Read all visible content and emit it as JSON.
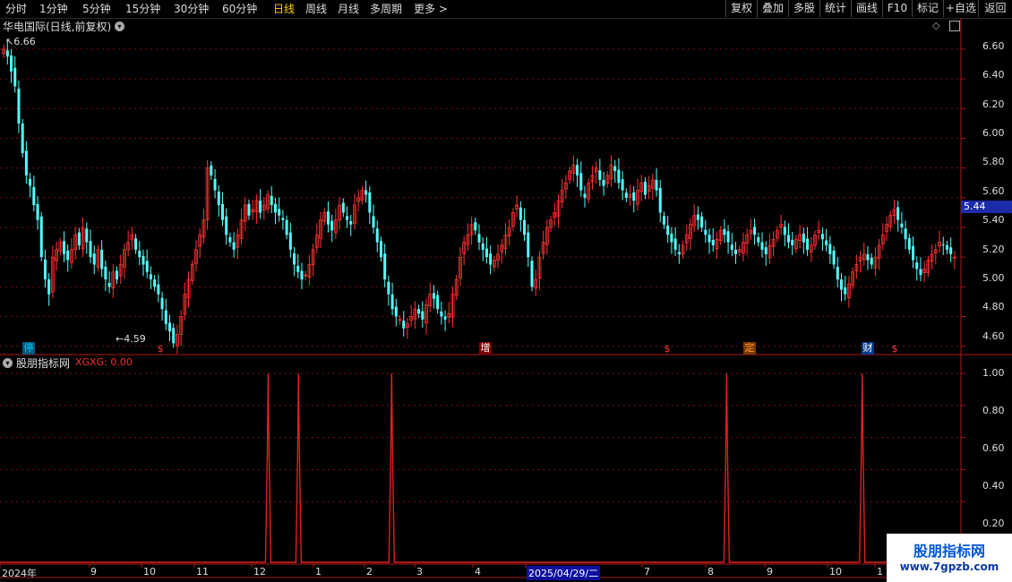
{
  "periods": [
    "分时",
    "1分钟",
    "5分钟",
    "15分钟",
    "30分钟",
    "60分钟",
    "日线",
    "周线",
    "月线",
    "多周期",
    "更多 >"
  ],
  "active_period": "日线",
  "toolbar": [
    "复权",
    "叠加",
    "多股",
    "统计",
    "画线",
    "F10",
    "标记",
    "+自选",
    "返回"
  ],
  "main_chart": {
    "title": "华电国际(日线,前复权)",
    "high_label": "6.66",
    "low_label": "4.59",
    "current_price": "5.44",
    "y_ticks": [
      "6.60",
      "6.40",
      "6.20",
      "6.00",
      "5.80",
      "5.60",
      "5.40",
      "5.20",
      "5.00",
      "4.80",
      "4.60"
    ],
    "event_badges": [
      {
        "char": "停",
        "color": "#00c8ff"
      },
      {
        "char": "$",
        "color": "#ff3a3a"
      },
      {
        "char": "增",
        "color": "#ffffff"
      },
      {
        "char": "$",
        "color": "#ff3a3a"
      },
      {
        "char": "定",
        "color": "#ff9a2a"
      },
      {
        "char": "财",
        "color": "#ffffff"
      },
      {
        "char": "$",
        "color": "#ff3a3a"
      }
    ]
  },
  "indicator": {
    "title": "股朋指标网",
    "series_label": "XGXG: 0.00",
    "y_ticks": [
      "1.00",
      "0.80",
      "0.60",
      "0.40",
      "0.20"
    ]
  },
  "x_axis": [
    "2024年",
    "9",
    "10",
    "11",
    "12",
    "1",
    "2",
    "3",
    "4",
    "2025/04/29/二",
    "7",
    "8",
    "9",
    "10",
    "1"
  ],
  "watermark": {
    "line1": "股朋指标网",
    "line2": "www.7gpzb.com"
  },
  "colors": {
    "up": "#ff3232",
    "down": "#54ffff",
    "grid": "#7a1010",
    "axis": "#b01818",
    "signal": "#e02020",
    "highlight": "#1010a0"
  },
  "chart_data": {
    "type": "candlestick",
    "price_range": [
      4.55,
      6.72
    ],
    "high": 6.66,
    "low": 4.59,
    "last": 5.44,
    "closes": [
      6.6,
      6.55,
      6.45,
      6.35,
      6.1,
      5.9,
      5.75,
      5.68,
      5.55,
      5.45,
      5.2,
      5.05,
      4.95,
      5.2,
      5.25,
      5.3,
      5.22,
      5.18,
      5.25,
      5.35,
      5.28,
      5.4,
      5.3,
      5.2,
      5.15,
      5.25,
      5.12,
      5.05,
      5.0,
      5.1,
      5.05,
      5.15,
      5.25,
      5.3,
      5.35,
      5.25,
      5.2,
      5.15,
      5.1,
      5.05,
      5.0,
      4.95,
      4.85,
      4.75,
      4.7,
      4.62,
      4.68,
      4.8,
      4.95,
      5.05,
      5.15,
      5.25,
      5.35,
      5.45,
      5.8,
      5.75,
      5.65,
      5.55,
      5.45,
      5.35,
      5.3,
      5.25,
      5.35,
      5.45,
      5.55,
      5.48,
      5.52,
      5.58,
      5.5,
      5.55,
      5.62,
      5.55,
      5.5,
      5.48,
      5.45,
      5.35,
      5.25,
      5.15,
      5.1,
      5.05,
      5.08,
      5.15,
      5.25,
      5.35,
      5.45,
      5.5,
      5.42,
      5.38,
      5.45,
      5.55,
      5.5,
      5.45,
      5.42,
      5.55,
      5.6,
      5.65,
      5.62,
      5.5,
      5.4,
      5.3,
      5.2,
      5.05,
      4.95,
      4.85,
      4.8,
      4.78,
      4.72,
      4.75,
      4.8,
      4.85,
      4.82,
      4.78,
      4.88,
      4.95,
      4.92,
      4.85,
      4.8,
      4.78,
      4.82,
      4.95,
      5.05,
      5.2,
      5.3,
      5.35,
      5.42,
      5.38,
      5.3,
      5.25,
      5.2,
      5.15,
      5.18,
      5.22,
      5.28,
      5.35,
      5.4,
      5.5,
      5.55,
      5.45,
      5.35,
      5.2,
      5.0,
      5.05,
      5.2,
      5.3,
      5.4,
      5.45,
      5.5,
      5.58,
      5.65,
      5.7,
      5.78,
      5.82,
      5.75,
      5.65,
      5.6,
      5.7,
      5.75,
      5.8,
      5.72,
      5.68,
      5.75,
      5.82,
      5.78,
      5.7,
      5.65,
      5.6,
      5.62,
      5.58,
      5.65,
      5.7,
      5.62,
      5.68,
      5.72,
      5.65,
      5.5,
      5.42,
      5.35,
      5.3,
      5.25,
      5.22,
      5.28,
      5.35,
      5.42,
      5.48,
      5.45,
      5.4,
      5.35,
      5.3,
      5.28,
      5.32,
      5.38,
      5.35,
      5.3,
      5.25,
      5.22,
      5.25,
      5.3,
      5.35,
      5.38,
      5.35,
      5.3,
      5.25,
      5.22,
      5.28,
      5.32,
      5.38,
      5.42,
      5.35,
      5.3,
      5.28,
      5.32,
      5.35,
      5.3,
      5.25,
      5.28,
      5.35,
      5.38,
      5.32,
      5.28,
      5.22,
      5.15,
      5.05,
      4.98,
      4.95,
      5.02,
      5.1,
      5.15,
      5.2,
      5.22,
      5.18,
      5.15,
      5.2,
      5.28,
      5.35,
      5.42,
      5.48,
      5.52,
      5.45,
      5.4,
      5.32,
      5.25,
      5.18,
      5.12,
      5.08,
      5.12,
      5.18,
      5.22,
      5.25,
      5.3,
      5.28,
      5.25,
      5.22,
      5.2
    ]
  },
  "indicator_data": {
    "type": "line",
    "ylim": [
      0,
      1
    ],
    "spike_values": [
      1,
      1,
      1,
      1,
      1
    ],
    "spike_positions": [
      0.265,
      0.295,
      0.387,
      0.718,
      0.852
    ]
  }
}
